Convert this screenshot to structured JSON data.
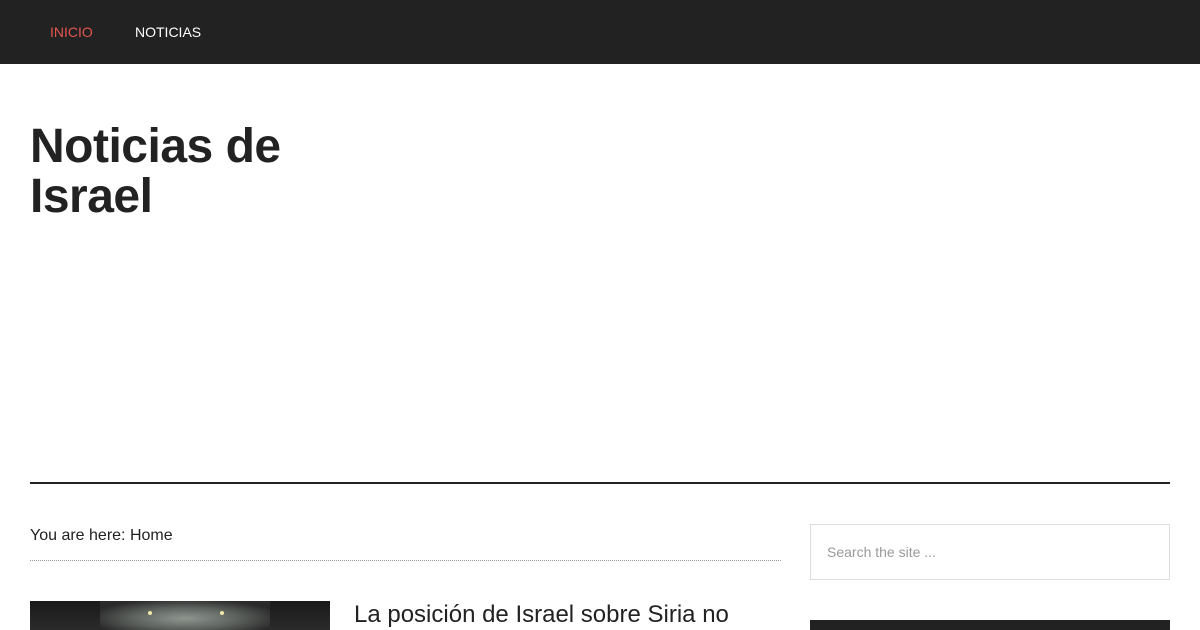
{
  "nav": {
    "items": [
      {
        "label": "INICIO",
        "active": true
      },
      {
        "label": "NOTICIAS",
        "active": false
      }
    ]
  },
  "site": {
    "title_line1": "Noticias de",
    "title_line2": "Israel"
  },
  "breadcrumb": {
    "prefix": "You are here: ",
    "current": "Home"
  },
  "post": {
    "title": "La posición de Israel sobre Siria no"
  },
  "search": {
    "placeholder": "Search the site ..."
  },
  "colors": {
    "nav_background": "#222222",
    "nav_active": "#e5554e",
    "text": "#222222"
  }
}
